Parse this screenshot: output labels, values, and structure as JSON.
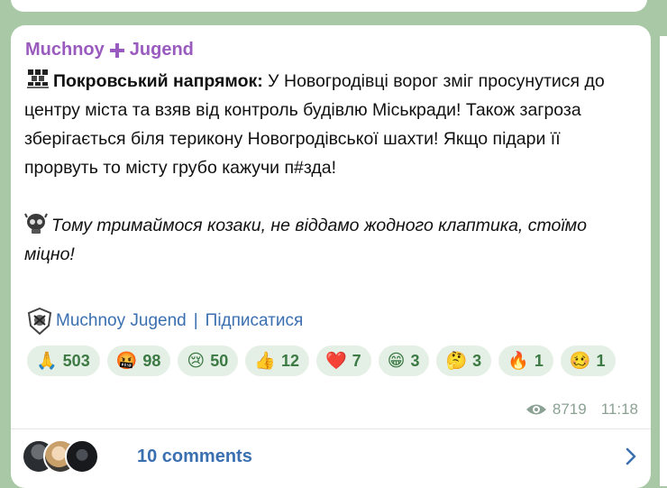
{
  "post": {
    "author": "Muchnoy",
    "author_suffix": "Jugend",
    "headline": "Покровський напрямок:",
    "line1_rest": " У Новогродівці ворог зміг просунутися до центру міста та взяв від контроль будівлю Міськради! Також загроза зберігається біля терикону Новогродівської шахти! Якщо підари її прорвуть то місту грубо кажучи п#зда!",
    "italic_text": "Тому тримаймося козаки, не віддамо жодного клаптика, стоїмо міцно!",
    "signature_name": "Muchnoy Jugend",
    "signature_sep": "|",
    "signature_link": "Підписатися"
  },
  "reactions": [
    {
      "emoji": "🙏",
      "count": "503"
    },
    {
      "emoji": "🤬",
      "count": "98"
    },
    {
      "emoji": "😢",
      "count": "50"
    },
    {
      "emoji": "👍",
      "count": "12"
    },
    {
      "emoji": "❤️",
      "count": "7"
    },
    {
      "emoji": "😁",
      "count": "3"
    },
    {
      "emoji": "🤔",
      "count": "3"
    },
    {
      "emoji": "🔥",
      "count": "1"
    },
    {
      "emoji": "🥴",
      "count": "1"
    }
  ],
  "meta": {
    "views": "8719",
    "time": "11:18"
  },
  "comments": {
    "label": "10 comments"
  },
  "colors": {
    "author": "#9a5bbf",
    "link": "#3a6fb0",
    "reaction_bg": "#e4efe5",
    "reaction_text": "#3c7a44",
    "chat_bg": "#a9c8a6"
  }
}
